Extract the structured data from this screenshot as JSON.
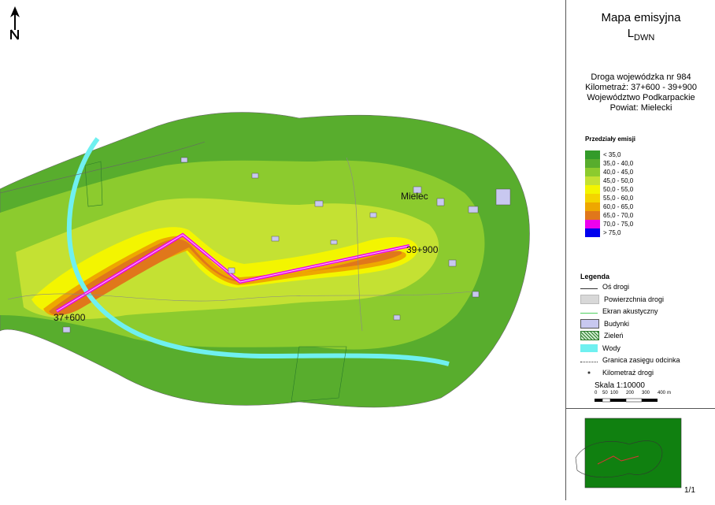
{
  "map": {
    "place_label": "Mielec",
    "km_start_label": "37+600",
    "km_end_label": "39+900",
    "north_arrow": "north-arrow-icon"
  },
  "panel": {
    "title": "Mapa emisyjna",
    "subtitle_main": "L",
    "subtitle_sub": "DWN",
    "road": "Droga wojewódzka nr 984",
    "kilometraz": "Kilometraż: 37+600 - 39+900",
    "wojewodztwo": "Województwo Podkarpackie",
    "powiat": "Powiat: Mielecki",
    "ranges_title": "Przedziały emisji",
    "ranges": [
      {
        "label": "< 35,0",
        "color": "#339b2a"
      },
      {
        "label": "35,0 - 40,0",
        "color": "#58ad2d"
      },
      {
        "label": "40,0 - 45,0",
        "color": "#8ccb2e"
      },
      {
        "label": "45,0 - 50,0",
        "color": "#c4e133"
      },
      {
        "label": "50,0 - 55,0",
        "color": "#f3f500"
      },
      {
        "label": "55,0 - 60,0",
        "color": "#f4d400"
      },
      {
        "label": "60,0 - 65,0",
        "color": "#eea700"
      },
      {
        "label": "65,0 - 70,0",
        "color": "#e0771b"
      },
      {
        "label": "70,0 - 75,0",
        "color": "#ee00ee"
      },
      {
        "label": "> 75,0",
        "color": "#0000ee"
      }
    ],
    "legend_title": "Legenda",
    "legend": [
      {
        "label": "Oś drogi",
        "symbol": "line-dark"
      },
      {
        "label": "Powierzchnia drogi",
        "symbol": "fill-gray"
      },
      {
        "label": "Ekran akustyczny",
        "symbol": "line-green"
      },
      {
        "label": "Budynki",
        "symbol": "fill-lavender"
      },
      {
        "label": "Zieleń",
        "symbol": "hatch-green"
      },
      {
        "label": "Wody",
        "symbol": "fill-cyan"
      },
      {
        "label": "Granica zasięgu odcinka",
        "symbol": "dotted-line"
      },
      {
        "label": "Kilometraż drogi",
        "symbol": "dot"
      }
    ],
    "scale_label": "Skala 1:10000",
    "scale_ticks": [
      "0",
      "50",
      "100",
      "200",
      "300",
      "400"
    ],
    "scale_unit": "m",
    "page_number": "1/1"
  }
}
